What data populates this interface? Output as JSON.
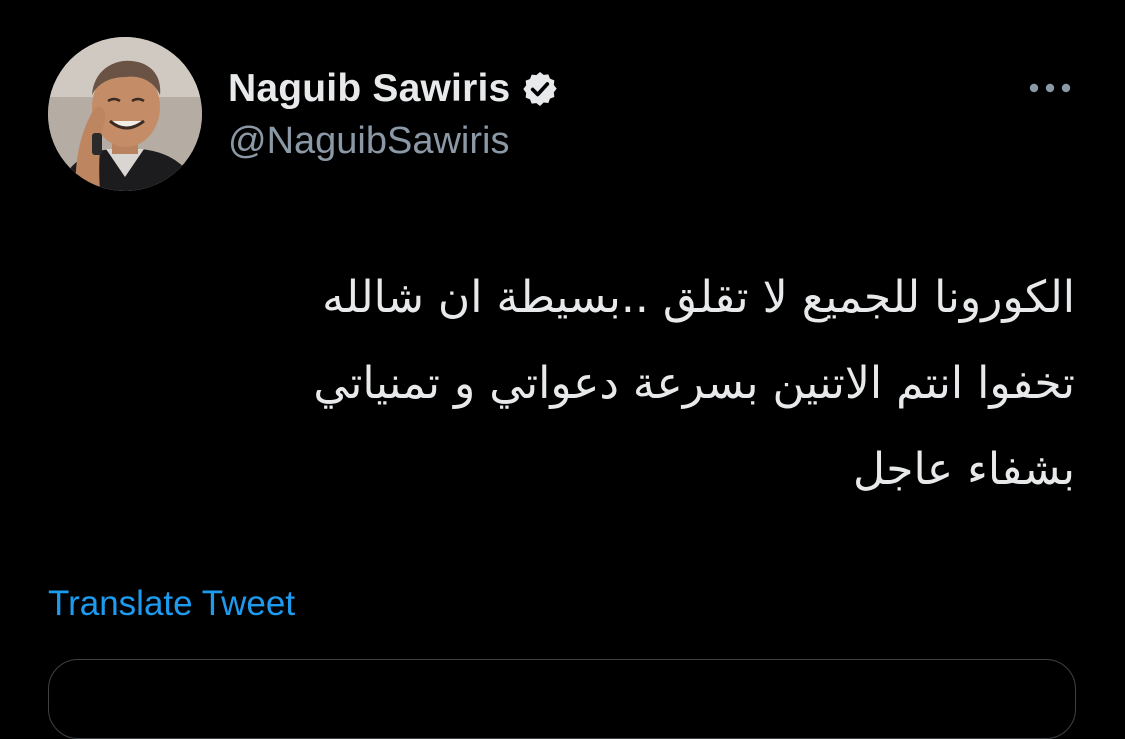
{
  "user": {
    "display_name": "Naguib Sawiris",
    "handle": "@NaguibSawiris",
    "verified": true
  },
  "icons": {
    "verified": "verified-badge-icon",
    "more": "more-horizontal-icon"
  },
  "tweet": {
    "lines": [
      "الكورونا للجميع لا تقلق ..بسيطة ان شالله",
      "تخفوا انتم الاتنين بسرعة دعواتي و تمنياتي",
      "بشفاء عاجل"
    ],
    "translate_label": "Translate Tweet"
  },
  "colors": {
    "background": "#000000",
    "primary_text": "#e7e9ea",
    "secondary_text": "#8b98a5",
    "link": "#1d9bf0",
    "border": "#3e4144"
  }
}
